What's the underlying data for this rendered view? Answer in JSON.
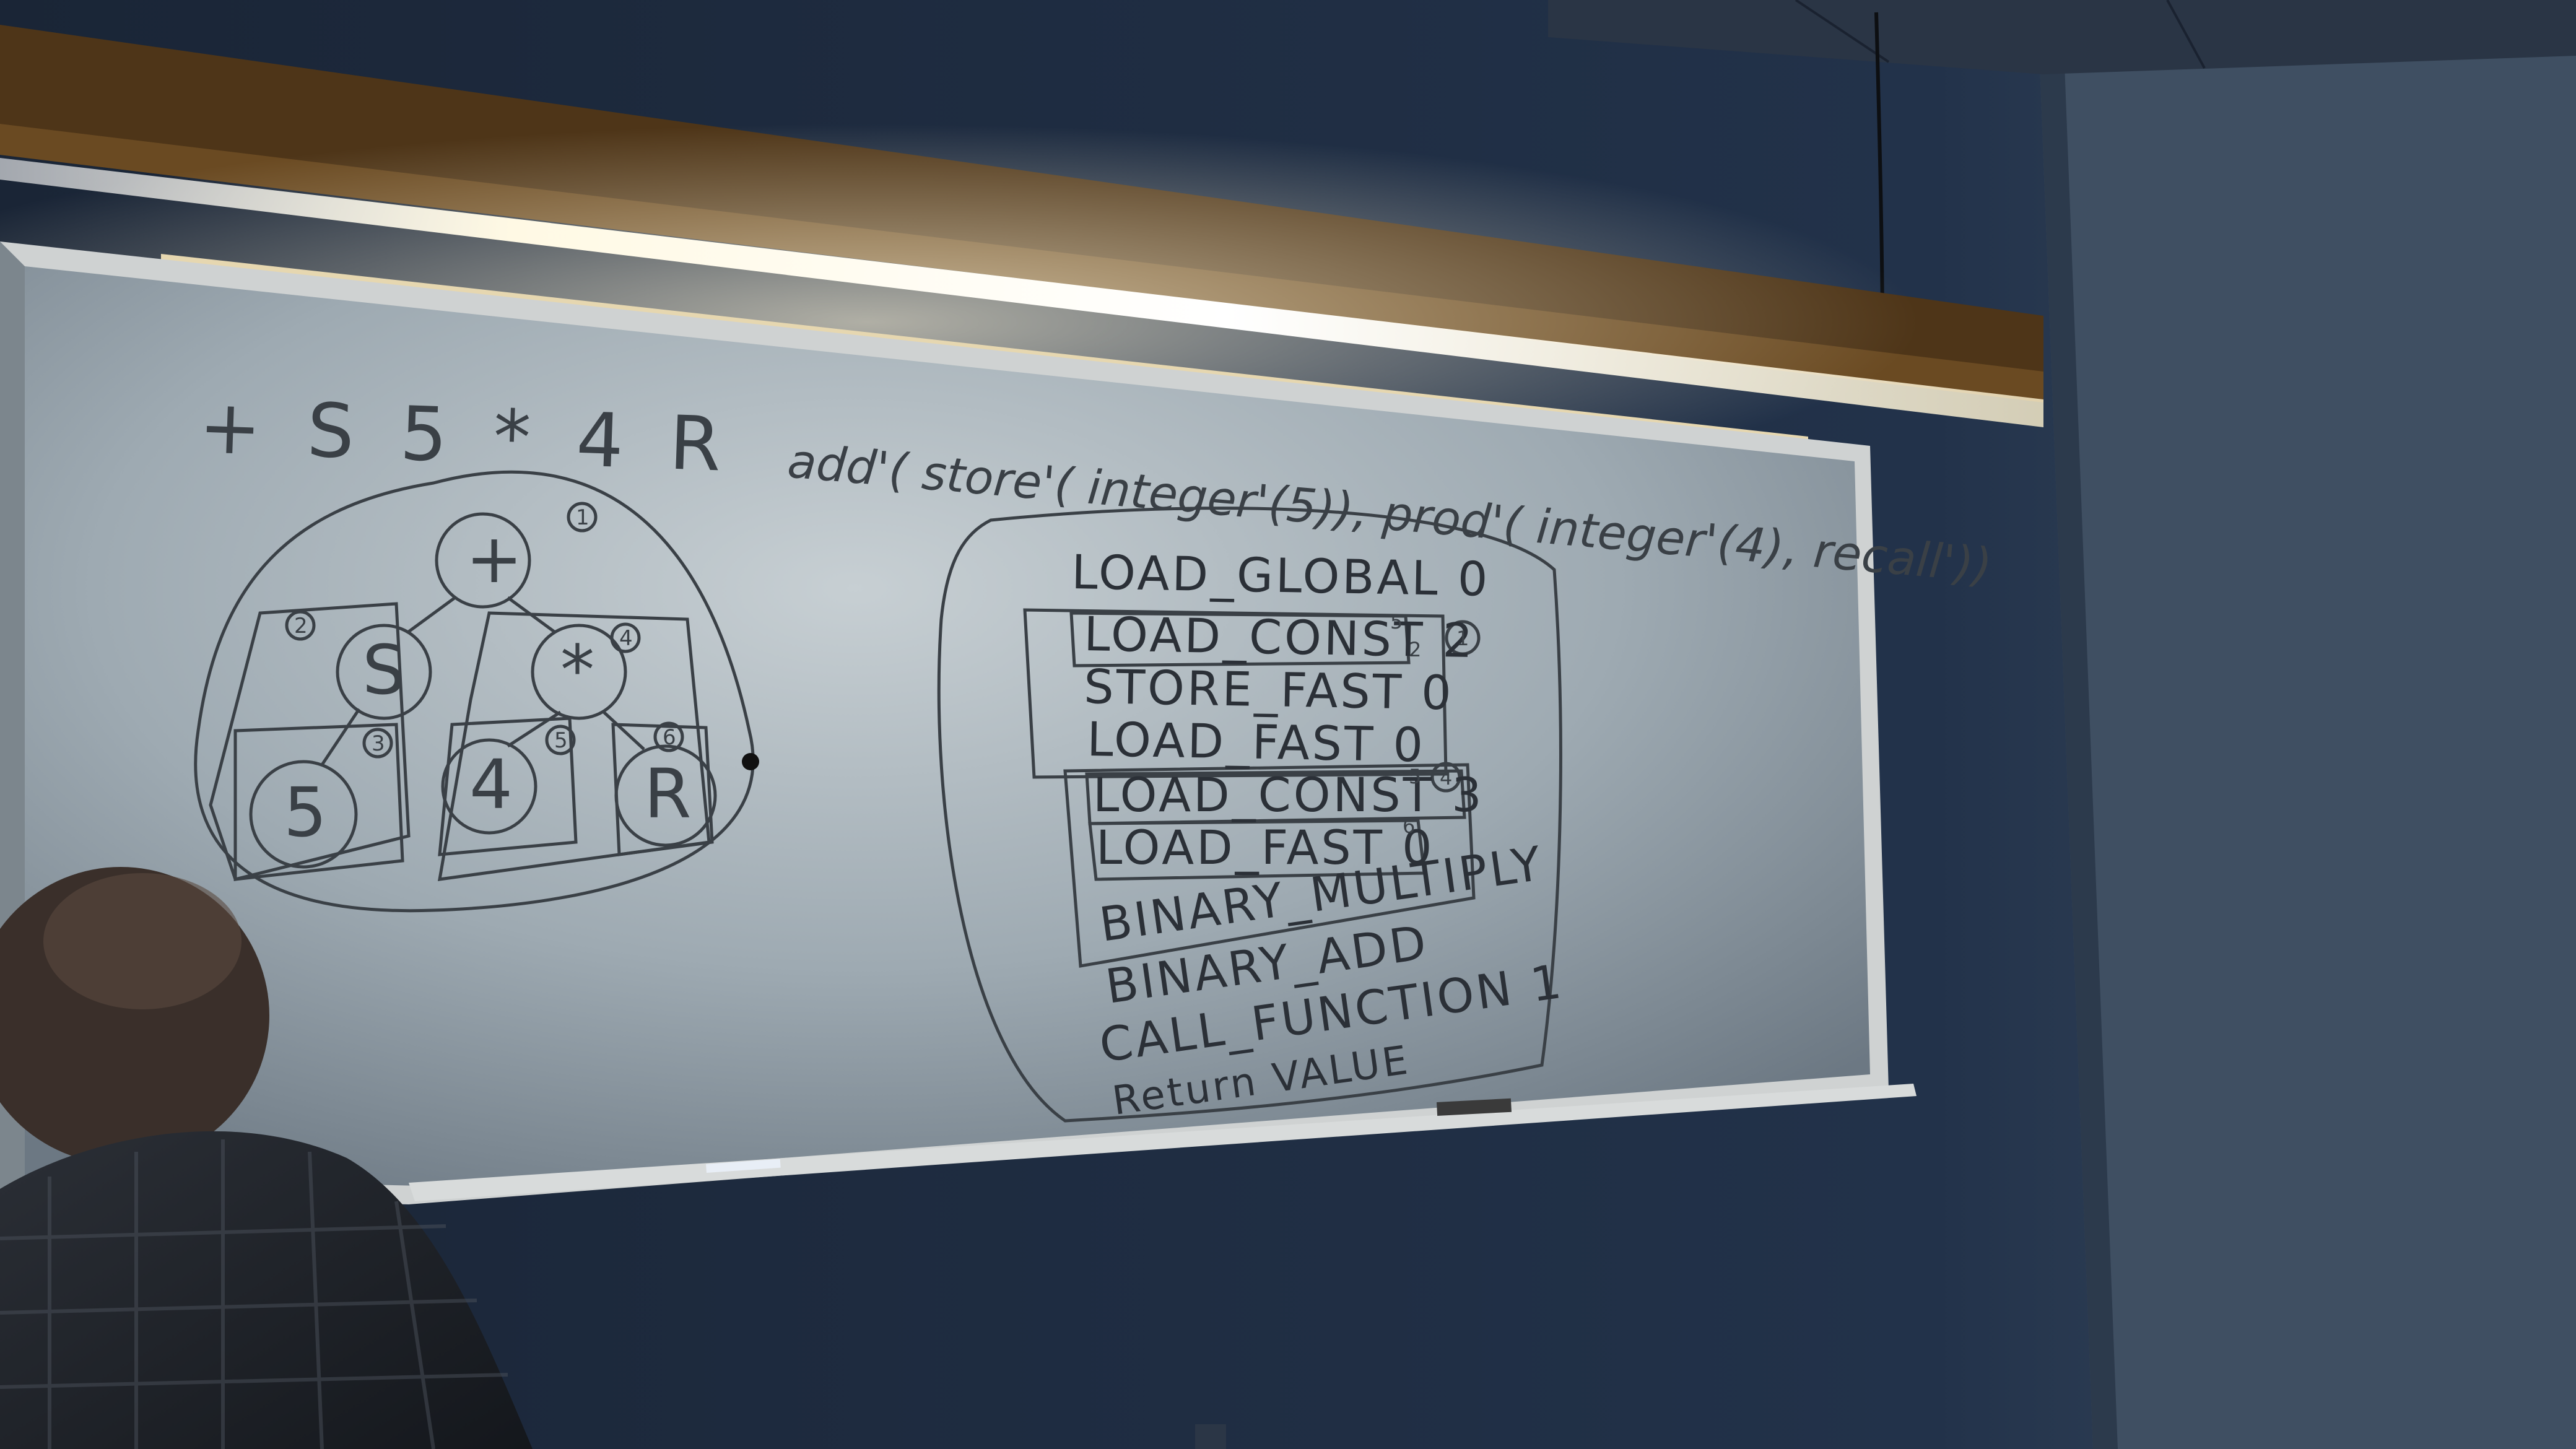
{
  "whiteboard": {
    "prefix_expression": "+ S 5 * 4 R",
    "functional_expression": "add'( store'( integer'(5)), prod'( integer'(4), recall'))",
    "tree": {
      "root": "+",
      "left": "S",
      "right": "*",
      "leaves": [
        "5",
        "4",
        "R"
      ],
      "annotations": [
        "1",
        "2",
        "3",
        "4",
        "5",
        "6"
      ]
    },
    "bytecode": [
      {
        "op": "LOAD_GLOBAL 0",
        "tags": []
      },
      {
        "op": "LOAD_CONST 2",
        "tags": [
          "5",
          "2",
          "1"
        ]
      },
      {
        "op": "STORE_FAST 0",
        "tags": []
      },
      {
        "op": "LOAD_FAST 0",
        "tags": []
      },
      {
        "op": "LOAD_CONST 3",
        "tags": [
          "5",
          "4"
        ]
      },
      {
        "op": "LOAD_FAST 0",
        "tags": [
          "6"
        ]
      },
      {
        "op": "BINARY_MULTIPLY",
        "tags": []
      },
      {
        "op": "BINARY_ADD",
        "tags": []
      },
      {
        "op": "CALL_FUNCTION 1",
        "tags": []
      },
      {
        "op": "Return VALUE",
        "tags": []
      }
    ]
  },
  "colors": {
    "wall": "#1c2a3c",
    "wall_right": "#3b4b5e",
    "board": "#aeb8be",
    "marker": "#3a4046",
    "light": "#fff6dc",
    "trim": "#5a3a1a"
  }
}
